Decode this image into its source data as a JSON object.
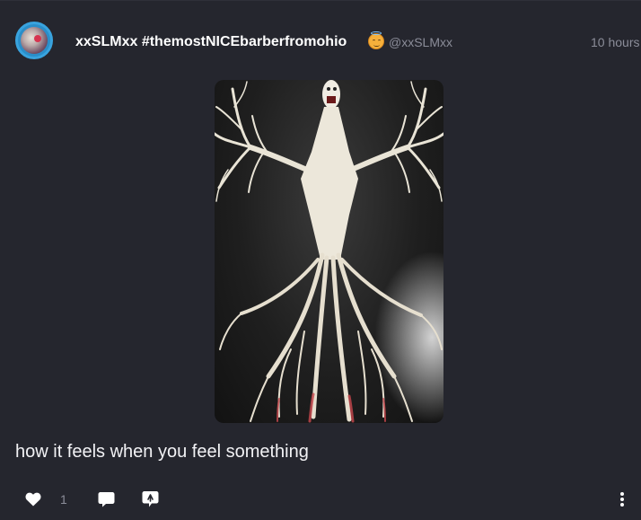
{
  "post": {
    "author": {
      "display_name": "xxSLMxx #themostNICEbarberfromohio",
      "emoji": "smiling-face-with-halo",
      "handle": "@xxSLMxx"
    },
    "timestamp": "10 hours",
    "text": "how it feels when you feel something",
    "actions": {
      "like_count": "1"
    }
  },
  "colors": {
    "background": "#25262e",
    "text": "#ffffff",
    "muted": "#8b8d99",
    "avatar_ring": "#39a3de"
  },
  "icons": [
    "like-heart-icon",
    "comment-bubble-icon",
    "share-icon",
    "more-vertical-icon"
  ]
}
